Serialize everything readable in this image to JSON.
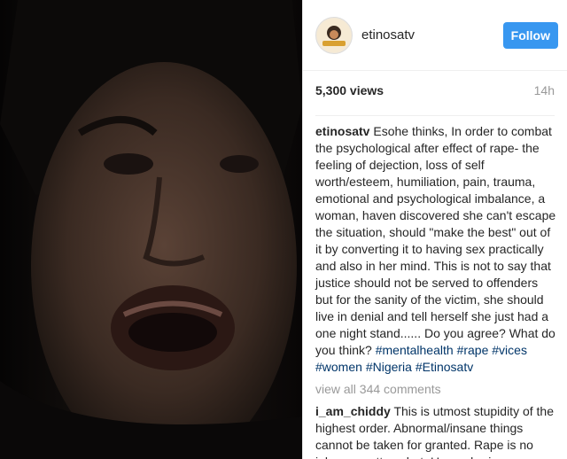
{
  "post": {
    "username": "etinosatv",
    "follow_label": "Follow",
    "views": "5,300 views",
    "time": "14h",
    "caption": {
      "username": "etinosatv",
      "text": "Esohe thinks, In order to combat the psychological after effect of rape- the feeling of dejection, loss of self worth/esteem, humiliation, pain, trauma, emotional and psychological imbalance, a woman, haven discovered she can't escape the situation, should \"make the best\" out of it by converting it to having sex practically and also in her mind. This is not to say that justice should not be served to offenders but for the sanity of the victim, she should live in denial and tell herself she just had a one night stand...... Do you agree? What do you think?",
      "hashtags": [
        "#mentalhealth",
        "#rape",
        "#vices",
        "#women",
        "#Nigeria",
        "#Etinosatv"
      ]
    },
    "view_all_comments": "view all 344 comments",
    "comment": {
      "username": "i_am_chiddy",
      "text": "This is utmost stupidity of the highest order. Abnormal/insane things cannot be taken for granted. Rape is no joke no matter what. Use ur brain"
    },
    "avatar_text": "Etinosa"
  },
  "colors": {
    "accent": "#3897f0",
    "hashtag": "#003569",
    "muted": "#999999"
  },
  "icons": {
    "video": "video-frame"
  }
}
